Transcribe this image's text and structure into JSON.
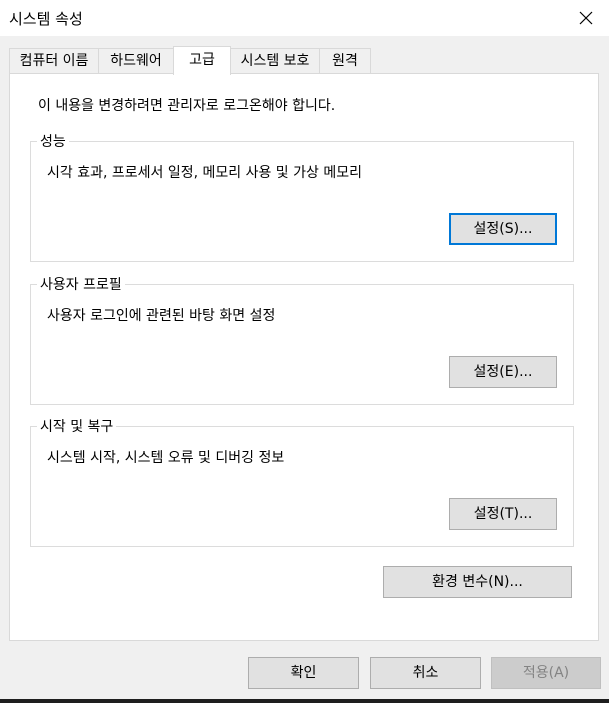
{
  "window": {
    "title": "시스템 속성",
    "close_icon": "close-icon"
  },
  "tabs": [
    {
      "label": "컴퓨터 이름",
      "active": false
    },
    {
      "label": "하드웨어",
      "active": false
    },
    {
      "label": "고급",
      "active": true
    },
    {
      "label": "시스템 보호",
      "active": false
    },
    {
      "label": "원격",
      "active": false
    }
  ],
  "advanced": {
    "notice": "이 내용을 변경하려면 관리자로 로그온해야 합니다.",
    "performance": {
      "label": "성능",
      "description": "시각 효과, 프로세서 일정, 메모리 사용 및 가상 메모리",
      "button": "설정(S)..."
    },
    "user_profiles": {
      "label": "사용자 프로필",
      "description": "사용자 로그인에 관련된 바탕 화면 설정",
      "button": "설정(E)..."
    },
    "startup_recovery": {
      "label": "시작 및 복구",
      "description": "시스템 시작, 시스템 오류 및 디버깅 정보",
      "button": "설정(T)..."
    },
    "env_button": "환경 변수(N)..."
  },
  "footer": {
    "ok": "확인",
    "cancel": "취소",
    "apply": "적용(A)",
    "apply_enabled": false
  },
  "colors": {
    "focus_border": "#0078d7",
    "button_bg": "#e1e1e1",
    "disabled_text": "#838383"
  }
}
